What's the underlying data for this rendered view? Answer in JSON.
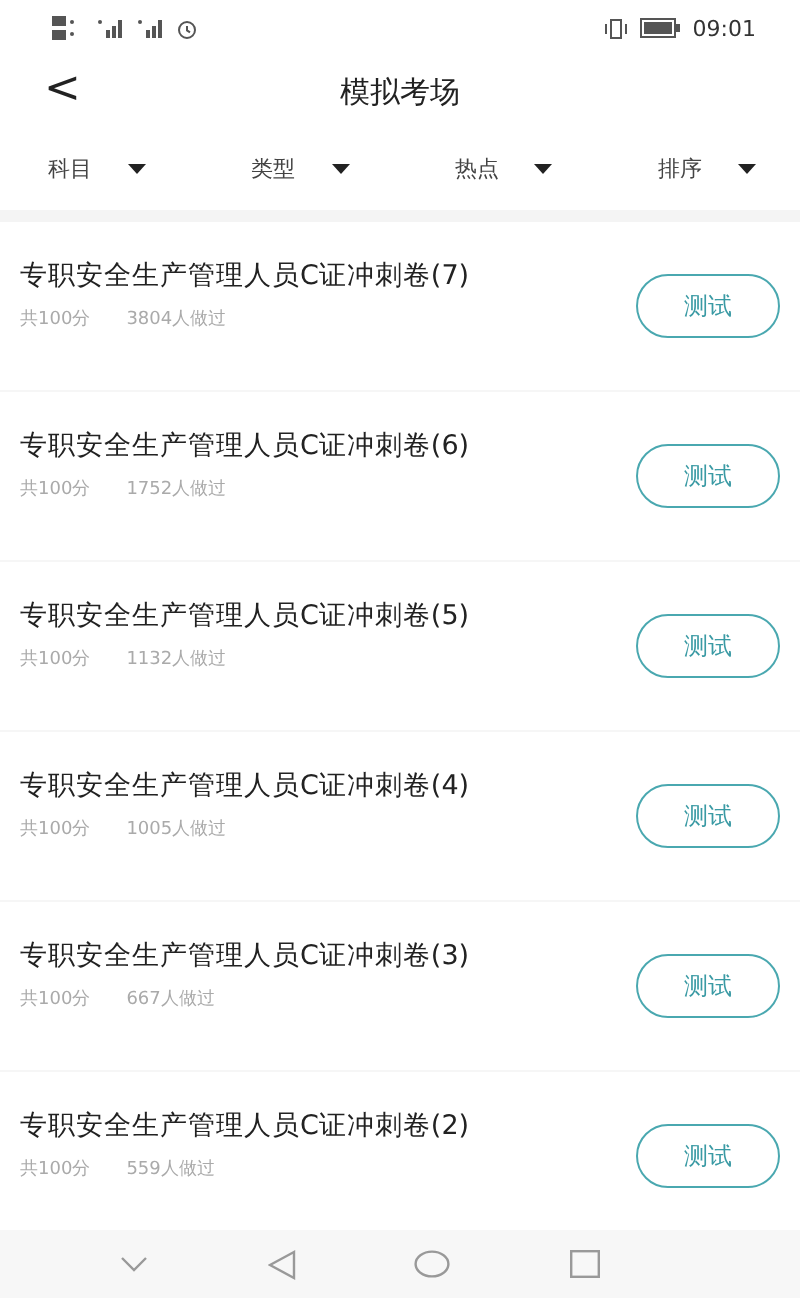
{
  "status_bar": {
    "time": "09:01"
  },
  "header": {
    "back": "<",
    "title": "模拟考场"
  },
  "filters": [
    {
      "label": "科目"
    },
    {
      "label": "类型"
    },
    {
      "label": "热点"
    },
    {
      "label": "排序"
    }
  ],
  "exams": [
    {
      "title": "专职安全生产管理人员C证冲刺卷(7)",
      "score": "共100分",
      "count": "3804人做过",
      "action": "测试"
    },
    {
      "title": "专职安全生产管理人员C证冲刺卷(6)",
      "score": "共100分",
      "count": "1752人做过",
      "action": "测试"
    },
    {
      "title": "专职安全生产管理人员C证冲刺卷(5)",
      "score": "共100分",
      "count": "1132人做过",
      "action": "测试"
    },
    {
      "title": "专职安全生产管理人员C证冲刺卷(4)",
      "score": "共100分",
      "count": "1005人做过",
      "action": "测试"
    },
    {
      "title": "专职安全生产管理人员C证冲刺卷(3)",
      "score": "共100分",
      "count": "667人做过",
      "action": "测试"
    },
    {
      "title": "专职安全生产管理人员C证冲刺卷(2)",
      "score": "共100分",
      "count": "559人做过",
      "action": "测试"
    }
  ]
}
